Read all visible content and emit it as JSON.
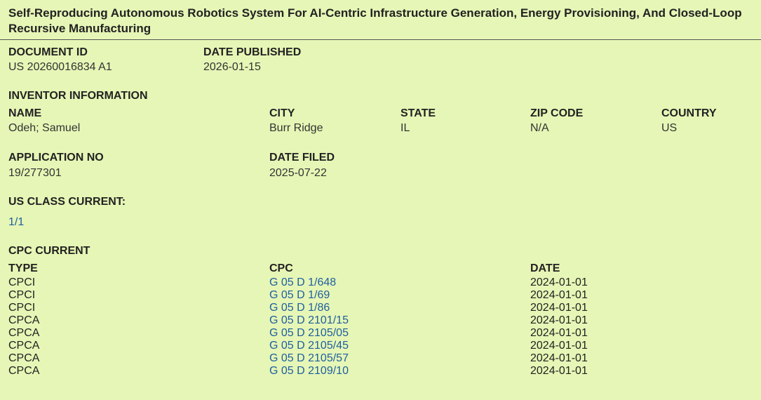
{
  "title": "Self-Reproducing Autonomous Robotics System For AI-Centric Infrastructure Generation, Energy Provisioning, And Closed-Loop Recursive Manufacturing",
  "document_id": {
    "label": "DOCUMENT ID",
    "value": "US 20260016834 A1"
  },
  "date_published": {
    "label": "DATE PUBLISHED",
    "value": "2026-01-15"
  },
  "inventor": {
    "section_label": "INVENTOR INFORMATION",
    "headers": {
      "name": "NAME",
      "city": "CITY",
      "state": "STATE",
      "zip": "ZIP CODE",
      "country": "COUNTRY"
    },
    "values": {
      "name": "Odeh; Samuel",
      "city": "Burr Ridge",
      "state": "IL",
      "zip": "N/A",
      "country": "US"
    }
  },
  "application_no": {
    "label": "APPLICATION NO",
    "value": "19/277301"
  },
  "date_filed": {
    "label": "DATE FILED",
    "value": "2025-07-22"
  },
  "us_class": {
    "label": "US CLASS CURRENT:",
    "value": "1/1"
  },
  "cpc": {
    "section_label": "CPC CURRENT",
    "headers": {
      "type": "TYPE",
      "cpc": "CPC",
      "date": "DATE"
    },
    "rows": [
      {
        "type": "CPCI",
        "cpc": "G 05 D 1/648",
        "date": "2024-01-01"
      },
      {
        "type": "CPCI",
        "cpc": "G 05 D 1/69",
        "date": "2024-01-01"
      },
      {
        "type": "CPCI",
        "cpc": "G 05 D 1/86",
        "date": "2024-01-01"
      },
      {
        "type": "CPCA",
        "cpc": "G 05 D 2101/15",
        "date": "2024-01-01"
      },
      {
        "type": "CPCA",
        "cpc": "G 05 D 2105/05",
        "date": "2024-01-01"
      },
      {
        "type": "CPCA",
        "cpc": "G 05 D 2105/45",
        "date": "2024-01-01"
      },
      {
        "type": "CPCA",
        "cpc": "G 05 D 2105/57",
        "date": "2024-01-01"
      },
      {
        "type": "CPCA",
        "cpc": "G 05 D 2109/10",
        "date": "2024-01-01"
      }
    ]
  }
}
